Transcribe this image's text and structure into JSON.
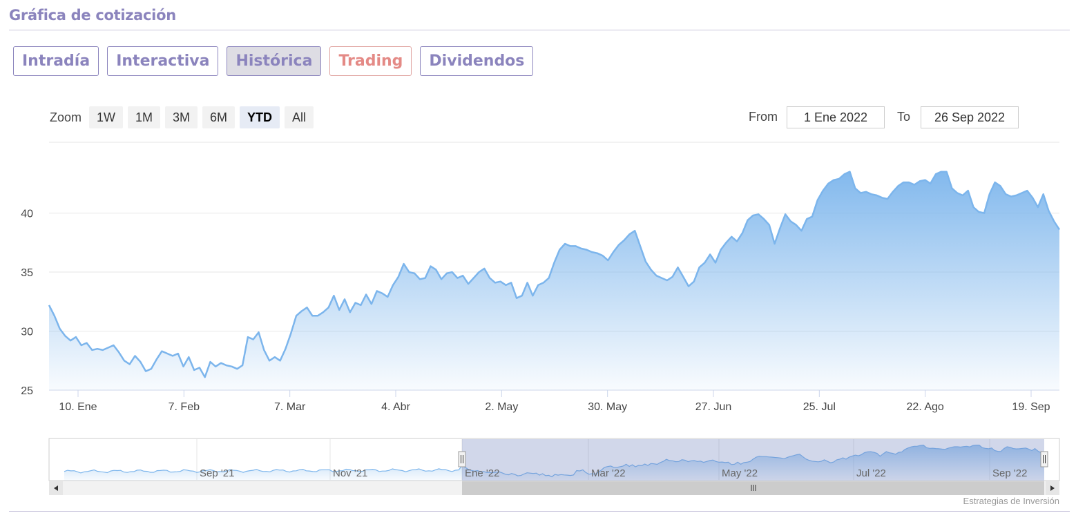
{
  "section_title": "Gráfica de cotización",
  "tabs": [
    {
      "label": "Intradía",
      "active": false
    },
    {
      "label": "Interactiva",
      "active": false
    },
    {
      "label": "Histórica",
      "active": true
    },
    {
      "label": "Trading",
      "active": false
    },
    {
      "label": "Dividendos",
      "active": false
    }
  ],
  "zoom": {
    "label": "Zoom",
    "buttons": [
      "1W",
      "1M",
      "3M",
      "6M",
      "YTD",
      "All"
    ],
    "active": "YTD"
  },
  "range": {
    "from_label": "From",
    "from_value": "1 Ene 2022",
    "to_label": "To",
    "to_value": "26 Sep 2022"
  },
  "colors": {
    "accent": "#8b84bd",
    "trading": "#e48a86",
    "line": "#7cb5ec"
  },
  "credit": "Estrategias de Inversión",
  "chart_data": {
    "type": "area",
    "title": "",
    "xlabel": "",
    "ylabel": "",
    "ylim": [
      25,
      46
    ],
    "y_ticks": [
      25,
      30,
      35,
      40
    ],
    "x_ticks": [
      "10. Ene",
      "7. Feb",
      "7. Mar",
      "4. Abr",
      "2. May",
      "30. May",
      "27. Jun",
      "25. Jul",
      "22. Ago",
      "19. Sep"
    ],
    "grid": true,
    "series": [
      {
        "values": [
          32.2,
          31.3,
          30.2,
          29.6,
          29.2,
          29.5,
          28.8,
          29.0,
          28.4,
          28.5,
          28.4,
          28.6,
          28.8,
          28.2,
          27.5,
          27.2,
          27.9,
          27.4,
          26.6,
          26.8,
          27.6,
          28.3,
          28.1,
          27.9,
          28.1,
          27.0,
          27.8,
          26.7,
          26.9,
          26.1,
          27.4,
          27.0,
          27.3,
          27.1,
          27.0,
          26.8,
          27.1,
          29.5,
          29.3,
          29.9,
          28.4,
          27.5,
          27.8,
          27.5,
          28.5,
          29.8,
          31.3,
          31.7,
          32.0,
          31.3,
          31.3,
          31.6,
          32.0,
          33.0,
          31.8,
          32.7,
          31.6,
          32.4,
          32.2,
          33.1,
          32.3,
          33.4,
          33.2,
          32.9,
          33.9,
          34.6,
          35.7,
          35.0,
          34.9,
          34.4,
          34.5,
          35.5,
          35.2,
          34.4,
          34.9,
          35.0,
          34.5,
          34.7,
          34.0,
          34.5,
          35.0,
          35.3,
          34.5,
          34.1,
          34.2,
          33.9,
          34.1,
          32.8,
          33.0,
          34.1,
          33.0,
          33.9,
          34.1,
          34.5,
          35.8,
          36.9,
          37.4,
          37.2,
          37.2,
          37.0,
          36.9,
          36.7,
          36.6,
          36.4,
          36.0,
          36.7,
          37.3,
          37.7,
          38.2,
          38.5,
          37.2,
          35.9,
          35.2,
          34.7,
          34.5,
          34.3,
          34.6,
          35.4,
          34.6,
          33.8,
          34.2,
          35.4,
          35.8,
          36.5,
          35.8,
          36.9,
          37.5,
          38.0,
          37.6,
          38.3,
          39.4,
          39.8,
          39.9,
          39.5,
          39.0,
          37.4,
          38.7,
          39.9,
          39.3,
          39.0,
          38.5,
          39.5,
          39.7,
          41.1,
          41.9,
          42.5,
          42.8,
          42.9,
          43.3,
          43.5,
          42.1,
          41.7,
          41.8,
          41.6,
          41.5,
          41.3,
          41.2,
          41.8,
          42.3,
          42.6,
          42.6,
          42.4,
          42.7,
          42.8,
          42.5,
          43.3,
          43.5,
          43.5,
          42.1,
          41.7,
          41.5,
          41.9,
          40.5,
          40.1,
          40.0,
          41.6,
          42.6,
          42.3,
          41.6,
          41.4,
          41.5,
          41.7,
          41.9,
          41.3,
          40.5,
          41.6,
          40.2,
          39.3,
          38.6
        ]
      }
    ],
    "navigator": {
      "x_ticks": [
        "Sep '21",
        "Nov '21",
        "Ene '22",
        "Mar '22",
        "May '22",
        "Jul '22",
        "Sep '22"
      ]
    }
  }
}
